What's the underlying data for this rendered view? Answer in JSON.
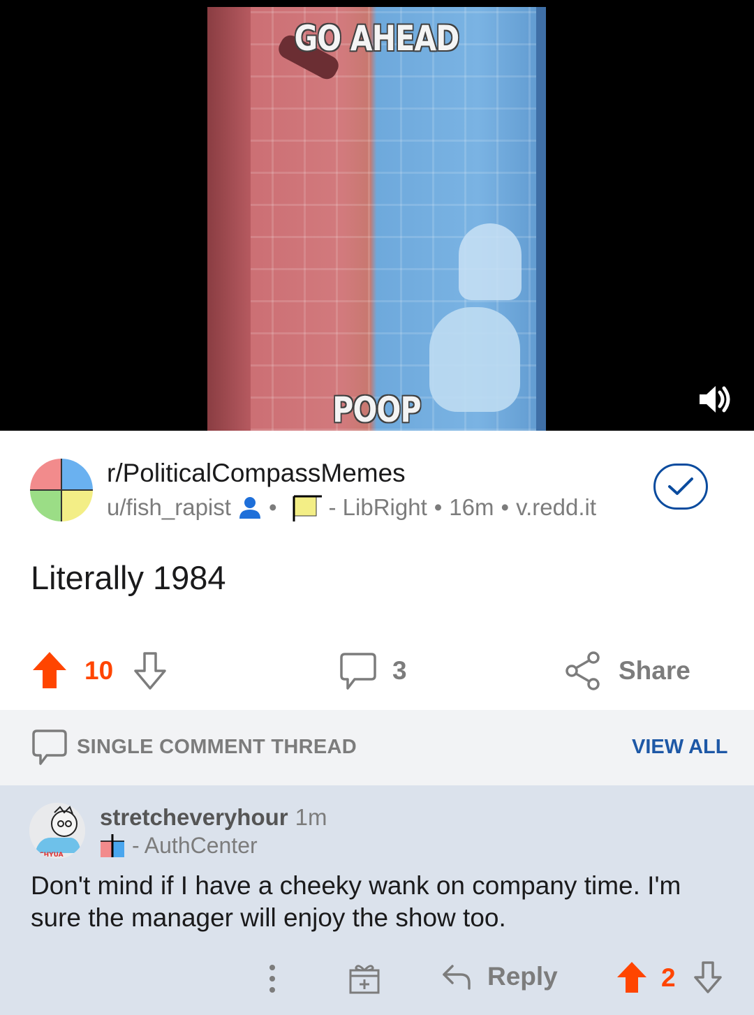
{
  "video": {
    "top_text": "GO AHEAD",
    "bottom_text": "POOP",
    "sound_icon": "volume-on-icon"
  },
  "post": {
    "subreddit": "r/PoliticalCompassMemes",
    "author": "u/fish_rapist",
    "flair": "- LibRight",
    "age": "16m",
    "domain": "v.redd.it",
    "title": "Literally 1984",
    "votes": "10",
    "comments": "3",
    "share_label": "Share"
  },
  "thread": {
    "label": "SINGLE COMMENT THREAD",
    "view_all": "VIEW ALL"
  },
  "comment": {
    "author": "stretcheveryhour",
    "age": "1m",
    "flair": "- AuthCenter",
    "avatar_text": "CHYUA",
    "body": "Don't mind if I have a cheeky wank on company time. I'm sure the manager will enjoy the show too.",
    "reply_label": "Reply",
    "votes": "2"
  },
  "colors": {
    "upvote": "#ff4500",
    "link": "#1e58a6",
    "comment_bg": "#dbe2ec",
    "thread_bg": "#f2f3f5"
  }
}
